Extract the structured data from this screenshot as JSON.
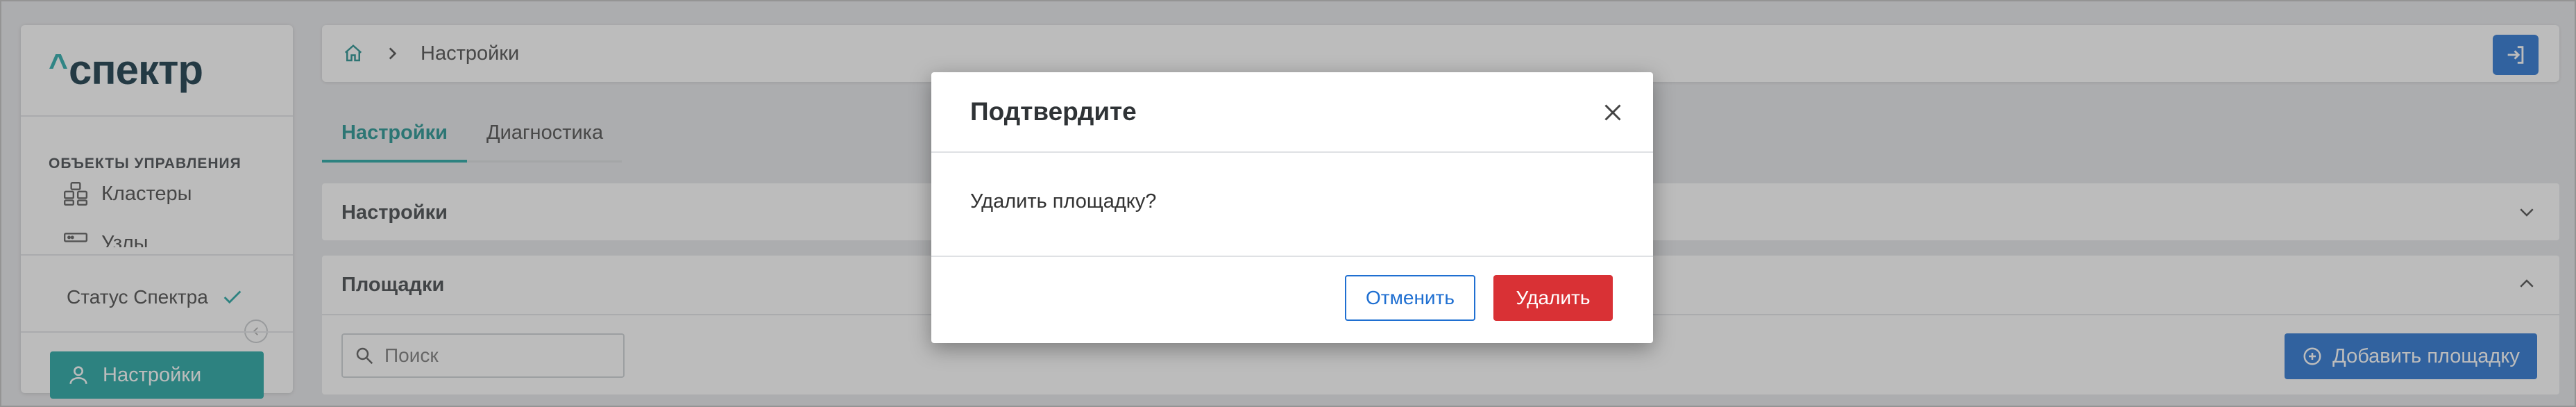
{
  "brand": {
    "caret": "^",
    "name": "спектр"
  },
  "sidebar": {
    "section_title": "ОБЪЕКТЫ УПРАВЛЕНИЯ",
    "items": [
      {
        "label": "Кластеры",
        "icon": "cluster-icon"
      },
      {
        "label": "Узлы",
        "icon": "server-icon"
      }
    ],
    "status_label": "Статус Спектра",
    "active_item": {
      "label": "Настройки",
      "icon": "user-icon"
    }
  },
  "header": {
    "breadcrumb": {
      "home_icon": "home-icon",
      "separator_icon": "chevron-right-icon",
      "current": "Настройки"
    },
    "logout_icon": "logout-icon"
  },
  "tabs": [
    {
      "label": "Настройки",
      "active": true
    },
    {
      "label": "Диагностика",
      "active": false
    }
  ],
  "panels": [
    {
      "title": "Настройки",
      "expanded": false
    },
    {
      "title": "Площадки",
      "expanded": true
    }
  ],
  "search": {
    "placeholder": "Поиск",
    "value": ""
  },
  "add_button": {
    "label": "Добавить площадку"
  },
  "modal": {
    "title": "Подтвердите",
    "message": "Удалить площадку?",
    "cancel_label": "Отменить",
    "delete_label": "Удалить"
  },
  "colors": {
    "accent": "#19a29f",
    "primary": "#1f6fd1",
    "danger": "#d93135",
    "brand_dark": "#0a2e3e"
  }
}
